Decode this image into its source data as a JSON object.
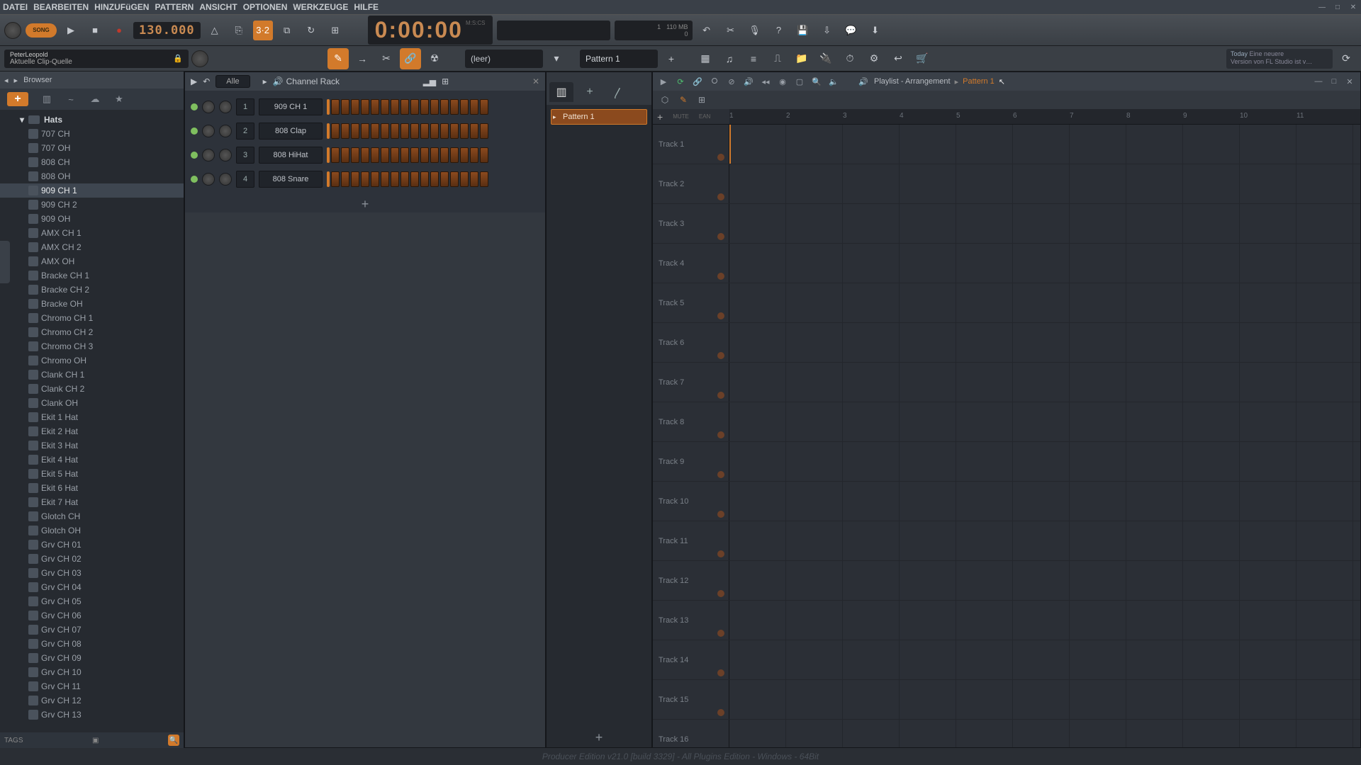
{
  "menu": {
    "items": [
      "DATEI",
      "BEARBEITEN",
      "HINZUFüGEN",
      "PATTERN",
      "ANSICHT",
      "OPTIONEN",
      "WERKZEUGE",
      "HILFE"
    ]
  },
  "hint": {
    "user": "PeterLeopold",
    "text": "Aktuelle Clip-Quelle"
  },
  "transport": {
    "mode": "SONG",
    "tempo": "130.000",
    "time_main": "0:00:",
    "time_sec": "00",
    "time_unit": "M:S:CS",
    "cpu_poly": "1",
    "cpu_mem": "110 MB",
    "cpu_voices": "0"
  },
  "patternbar": {
    "current": "Pattern 1",
    "snap": "(leer)"
  },
  "news": {
    "label": "Today",
    "line1": "Eine neuere",
    "line2": "Version von FL Studio ist v…"
  },
  "browser": {
    "title": "Browser",
    "folder": "Hats",
    "items": [
      "707 CH",
      "707 OH",
      "808 CH",
      "808 OH",
      "909 CH 1",
      "909 CH 2",
      "909 OH",
      "AMX CH 1",
      "AMX CH 2",
      "AMX OH",
      "Bracke CH 1",
      "Bracke CH 2",
      "Bracke OH",
      "Chromo CH 1",
      "Chromo CH 2",
      "Chromo CH 3",
      "Chromo OH",
      "Clank CH 1",
      "Clank CH 2",
      "Clank OH",
      "Ekit 1 Hat",
      "Ekit 2 Hat",
      "Ekit 3 Hat",
      "Ekit 4 Hat",
      "Ekit 5 Hat",
      "Ekit 6 Hat",
      "Ekit 7 Hat",
      "Glotch CH",
      "Glotch OH",
      "Grv CH 01",
      "Grv CH 02",
      "Grv CH 03",
      "Grv CH 04",
      "Grv CH 05",
      "Grv CH 06",
      "Grv CH 07",
      "Grv CH 08",
      "Grv CH 09",
      "Grv CH 10",
      "Grv CH 11",
      "Grv CH 12",
      "Grv CH 13"
    ],
    "selected": "909 CH 1",
    "tags_label": "TAGS"
  },
  "channelrack": {
    "title": "Channel Rack",
    "group": "Alle",
    "channels": [
      {
        "num": "1",
        "name": "909 CH 1"
      },
      {
        "num": "2",
        "name": "808 Clap"
      },
      {
        "num": "3",
        "name": "808 HiHat"
      },
      {
        "num": "4",
        "name": "808 Snare"
      }
    ]
  },
  "patternpicker": {
    "entry": "Pattern 1"
  },
  "playlist": {
    "title": "Playlist - Arrangement",
    "current": "Pattern 1",
    "ruler": [
      "1",
      "2",
      "3",
      "4",
      "5",
      "6",
      "7",
      "8",
      "9",
      "10",
      "11"
    ],
    "ruler_left_btn": "+",
    "ruler_left_labels": [
      "MUTE",
      "EAN"
    ],
    "tracks": [
      "Track 1",
      "Track 2",
      "Track 3",
      "Track 4",
      "Track 5",
      "Track 6",
      "Track 7",
      "Track 8",
      "Track 9",
      "Track 10",
      "Track 11",
      "Track 12",
      "Track 13",
      "Track 14",
      "Track 15",
      "Track 16"
    ]
  },
  "footer": {
    "text": "Producer Edition v21.0 [build 3329] - All Plugins Edition - Windows - 64Bit"
  }
}
